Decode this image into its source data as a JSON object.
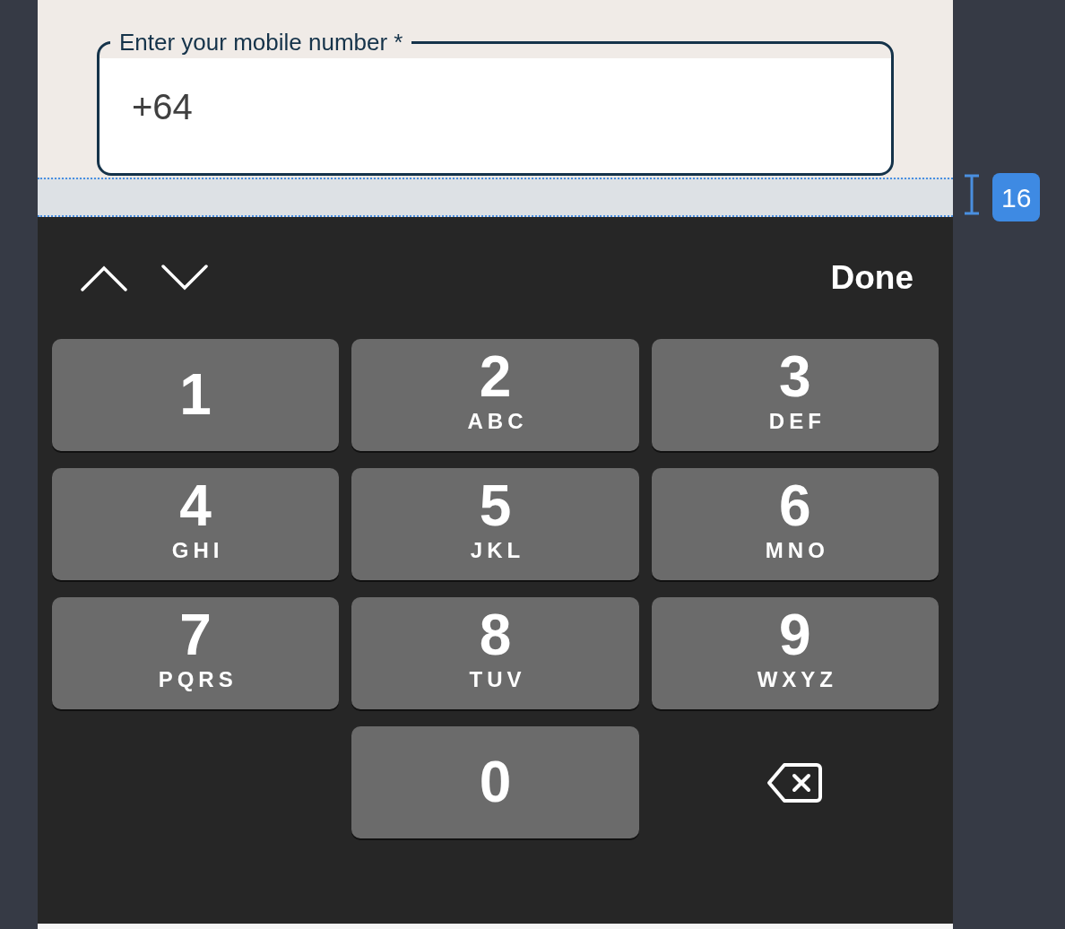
{
  "phone_field": {
    "label": "Enter your mobile number *",
    "value": "+64"
  },
  "spacing_annotation": {
    "value": "16"
  },
  "keyboard_toolbar": {
    "done": "Done"
  },
  "keys": [
    {
      "kind": "digit",
      "digit": "1"
    },
    {
      "kind": "digit",
      "digit": "2",
      "letters": "ABC"
    },
    {
      "kind": "digit",
      "digit": "3",
      "letters": "DEF"
    },
    {
      "kind": "digit",
      "digit": "4",
      "letters": "GHI"
    },
    {
      "kind": "digit",
      "digit": "5",
      "letters": "JKL"
    },
    {
      "kind": "digit",
      "digit": "6",
      "letters": "MNO"
    },
    {
      "kind": "digit",
      "digit": "7",
      "letters": "PQRS"
    },
    {
      "kind": "digit",
      "digit": "8",
      "letters": "TUV"
    },
    {
      "kind": "digit",
      "digit": "9",
      "letters": "WXYZ"
    },
    {
      "kind": "empty"
    },
    {
      "kind": "digit",
      "digit": "0"
    },
    {
      "kind": "delete"
    }
  ]
}
